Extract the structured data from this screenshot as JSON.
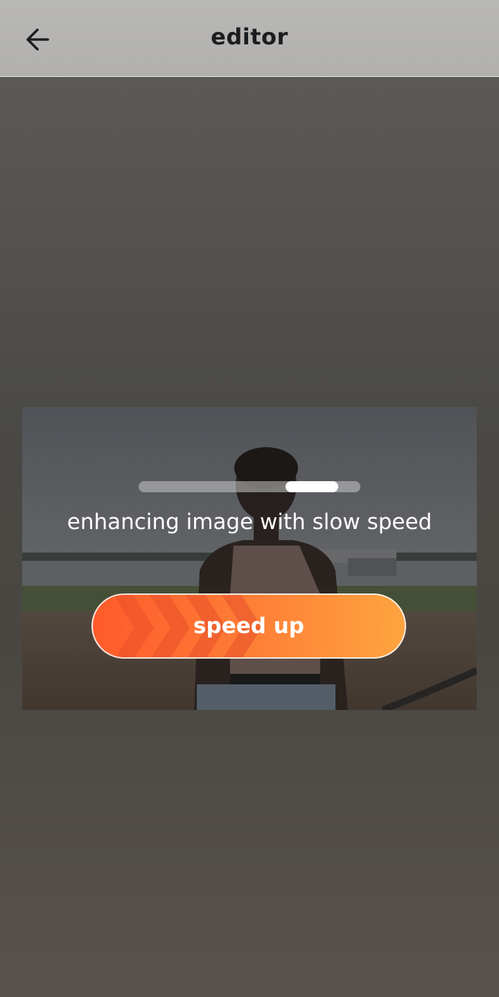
{
  "header": {
    "title": "editor",
    "back_icon": "arrow-left-icon"
  },
  "enhance": {
    "status_text": "enhancing image with slow speed",
    "progress": 0.78,
    "speed_up_label": "speed up"
  },
  "colors": {
    "header_bg": "#b5b4b2",
    "button_gradient_start": "#ff5a2b",
    "button_gradient_end": "#ffa440"
  }
}
